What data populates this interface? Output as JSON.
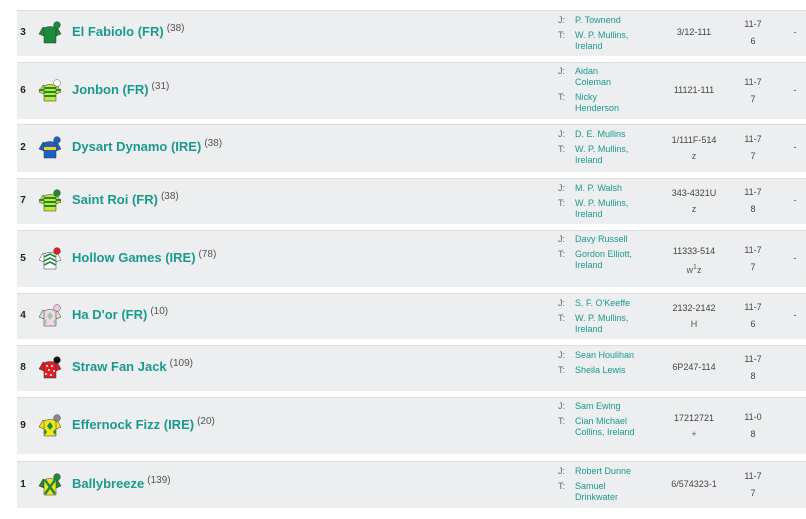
{
  "runners": [
    {
      "number": "3",
      "horse": "El Fabiolo (FR)",
      "rating": "(38)",
      "jockey": "P. Townend",
      "trainer": "W. P. Mullins, Ireland",
      "form": "3/12-111",
      "form_sub": "",
      "age": "11-7",
      "weight": "6",
      "odds": "-",
      "silk": {
        "body": "#1d8a3a",
        "sleeves": "#1d8a3a",
        "cap": "#1d8a3a",
        "pattern": "plain",
        "accent": "#ffffff"
      }
    },
    {
      "number": "6",
      "horse": "Jonbon (FR)",
      "rating": "(31)",
      "jockey": "Aidan Coleman",
      "trainer": "Nicky Henderson",
      "form": "11121-111",
      "form_sub": "",
      "age": "11-7",
      "weight": "7",
      "odds": "-",
      "silk": {
        "body": "#c8e62a",
        "sleeves": "#c8e62a",
        "cap": "#ffffff",
        "pattern": "hoops",
        "accent": "#1d8a3a"
      }
    },
    {
      "number": "2",
      "horse": "Dysart Dynamo (IRE)",
      "rating": "(38)",
      "jockey": "D. E. Mullins",
      "trainer": "W. P. Mullins, Ireland",
      "form": "1/111F-514",
      "form_sub": "z",
      "age": "11-7",
      "weight": "7",
      "odds": "-",
      "silk": {
        "body": "#1f5fbf",
        "sleeves": "#1f5fbf",
        "cap": "#1f5fbf",
        "pattern": "band",
        "accent": "#f2d21b"
      }
    },
    {
      "number": "7",
      "horse": "Saint Roi (FR)",
      "rating": "(38)",
      "jockey": "M. P. Walsh",
      "trainer": "W. P. Mullins, Ireland",
      "form": "343-4321U",
      "form_sub": "z",
      "age": "11-7",
      "weight": "8",
      "odds": "-",
      "silk": {
        "body": "#c8e62a",
        "sleeves": "#c8e62a",
        "cap": "#1d8a3a",
        "pattern": "hoops",
        "accent": "#1d8a3a"
      }
    },
    {
      "number": "5",
      "horse": "Hollow Games (IRE)",
      "rating": "(78)",
      "jockey": "Davy Russell",
      "trainer": "Gordon Elliott, Ireland",
      "form": "11333-514",
      "form_sub_pre": "w",
      "form_sub_sup": "1",
      "form_sub_post": "z",
      "age": "11-7",
      "weight": "7",
      "odds": "-",
      "silk": {
        "body": "#ffffff",
        "sleeves": "#ffffff",
        "cap": "#e02020",
        "pattern": "chevron",
        "accent": "#1d8a3a"
      }
    },
    {
      "number": "4",
      "horse": "Ha D'or (FR)",
      "rating": "(10)",
      "jockey": "S. F. O'Keeffe",
      "trainer": "W. P. Mullins, Ireland",
      "form": "2132-2142",
      "form_sub": "H",
      "age": "11-7",
      "weight": "6",
      "odds": "-",
      "silk": {
        "body": "#f0d7e6",
        "sleeves": "#d7e6d0",
        "cap": "#f0c8dc",
        "pattern": "diamonds",
        "accent": "#9fc7a8"
      }
    },
    {
      "number": "8",
      "horse": "Straw Fan Jack",
      "rating": "(109)",
      "jockey": "Sean Houlihan",
      "trainer": "Sheila Lewis",
      "form": "6P247-114",
      "form_sub": "",
      "age": "11-7",
      "weight": "8",
      "odds": "",
      "silk": {
        "body": "#d81f2a",
        "sleeves": "#d81f2a",
        "cap": "#111111",
        "pattern": "spots",
        "accent": "#ffffff"
      }
    },
    {
      "number": "9",
      "horse": "Effernock Fizz (IRE)",
      "rating": "(20)",
      "jockey": "Sam Ewing",
      "trainer": "Cian Michael Collins, Ireland",
      "form": "17212721",
      "form_sub": "+",
      "age": "11-0",
      "weight": "8",
      "odds": "",
      "silk": {
        "body": "#f2e51b",
        "sleeves": "#f2e51b",
        "cap": "#888888",
        "pattern": "diamonds",
        "accent": "#1d8a3a"
      }
    },
    {
      "number": "1",
      "horse": "Ballybreeze",
      "rating": "(139)",
      "jockey": "Robert Dunne",
      "trainer": "Samuel Drinkwater",
      "form": "6/574323-1",
      "form_sub": "",
      "age": "11-7",
      "weight": "7",
      "odds": "",
      "silk": {
        "body": "#f2e51b",
        "sleeves": "#1d8a3a",
        "cap": "#1d8a3a",
        "pattern": "cross",
        "accent": "#1d8a3a"
      }
    }
  ],
  "labels": {
    "jockey_prefix": "J:",
    "trainer_prefix": "T:"
  }
}
